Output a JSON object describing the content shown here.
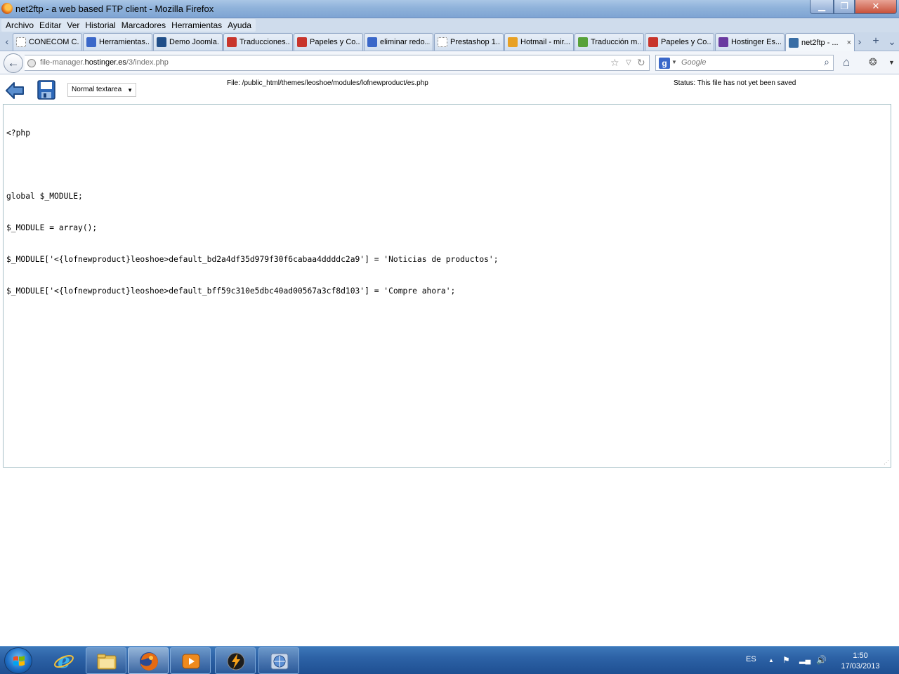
{
  "window": {
    "title": "net2ftp - a web based FTP client - Mozilla Firefox",
    "minimize_label": "▁",
    "maximize_label": "❐",
    "close_label": "✕"
  },
  "menubar": {
    "items": [
      "Archivo",
      "Editar",
      "Ver",
      "Historial",
      "Marcadores",
      "Herramientas",
      "Ayuda"
    ]
  },
  "tabs": [
    {
      "label": "CONECOM C...",
      "icon": "blank-page-icon",
      "color": "#ffffff"
    },
    {
      "label": "Herramientas...",
      "icon": "google-icon",
      "color": "#3b68c9"
    },
    {
      "label": "Demo Joomla...",
      "icon": "joomla-icon",
      "color": "#1f4e89"
    },
    {
      "label": "Traducciones...",
      "icon": "papeles-icon",
      "color": "#c8352c"
    },
    {
      "label": "Papeles y Co...",
      "icon": "papeles-icon",
      "color": "#c8352c"
    },
    {
      "label": "eliminar redo...",
      "icon": "google-icon",
      "color": "#3b68c9"
    },
    {
      "label": "Prestashop 1...",
      "icon": "blank-page-icon",
      "color": "#ffffff"
    },
    {
      "label": "Hotmail - mir...",
      "icon": "hotmail-icon",
      "color": "#e8a124"
    },
    {
      "label": "Traducción m...",
      "icon": "prestashop-icon",
      "color": "#58a23a"
    },
    {
      "label": "Papeles y Co...",
      "icon": "papeles-icon",
      "color": "#c8352c"
    },
    {
      "label": "Hostinger Es...",
      "icon": "hostinger-icon",
      "color": "#6a3aa0"
    },
    {
      "label": "net2ftp - ...",
      "icon": "net2ftp-icon",
      "color": "#3a6ea5",
      "active": true
    }
  ],
  "tab_close_label": "×",
  "tab_scroll_left": "‹",
  "tab_scroll_right": "›",
  "tab_new": "+",
  "tab_list": "⌄",
  "navbar": {
    "url_before": "file-manager.",
    "url_host": "hostinger.es",
    "url_after": "/3/index.php",
    "search_placeholder": "Google",
    "search_engine_letter": "g"
  },
  "toolbar": {
    "mode_selected": "Normal textarea",
    "file_path": "File: /public_html/themes/leoshoe/modules/lofnewproduct/es.php",
    "status": "Status: This file has not yet been saved"
  },
  "editor": {
    "lines": [
      "<?php",
      "",
      "global $_MODULE;",
      "$_MODULE = array();",
      "$_MODULE['<{lofnewproduct}leoshoe>default_bd2a4df35d979f30f6cabaa4ddddc2a9'] = 'Noticias de productos';",
      "$_MODULE['<{lofnewproduct}leoshoe>default_bff59c310e5dbc40ad00567a3cf8d103'] = 'Compre ahora';"
    ]
  },
  "taskbar": {
    "items": [
      {
        "name": "internet-explorer",
        "icon": "ie-icon"
      },
      {
        "name": "file-explorer",
        "icon": "folder-icon"
      },
      {
        "name": "firefox",
        "icon": "firefox-icon",
        "active": true
      },
      {
        "name": "media-player",
        "icon": "media-player-icon"
      },
      {
        "name": "winamp",
        "icon": "winamp-icon"
      },
      {
        "name": "network-app",
        "icon": "network-globe-icon"
      }
    ],
    "language": "ES",
    "time": "1:50",
    "date": "17/03/2013"
  }
}
